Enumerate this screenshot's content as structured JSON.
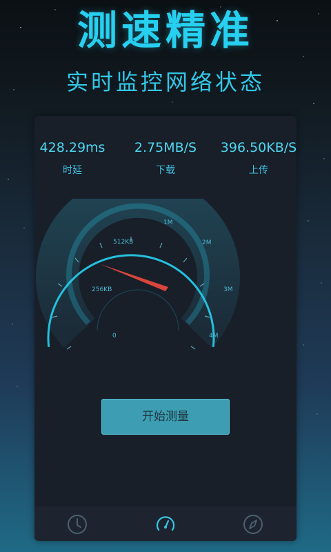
{
  "header": {
    "headline": "测速精准",
    "subline": "实时监控网络状态"
  },
  "stats": [
    {
      "value": "428.29ms",
      "label": "时延"
    },
    {
      "value": "2.75MB/S",
      "label": "下载"
    },
    {
      "value": "396.50KB/S",
      "label": "上传"
    }
  ],
  "gauge": {
    "scale_labels": [
      "0",
      "256KB",
      "512KB",
      "1M",
      "2M",
      "3M",
      "4M"
    ],
    "needle_color": "#ff5a4e",
    "accent_color": "#27d0f0"
  },
  "action": {
    "start_label": "开始测量"
  },
  "tabs": [
    {
      "icon": "clock-icon"
    },
    {
      "icon": "speedometer-icon"
    },
    {
      "icon": "compass-icon"
    }
  ]
}
